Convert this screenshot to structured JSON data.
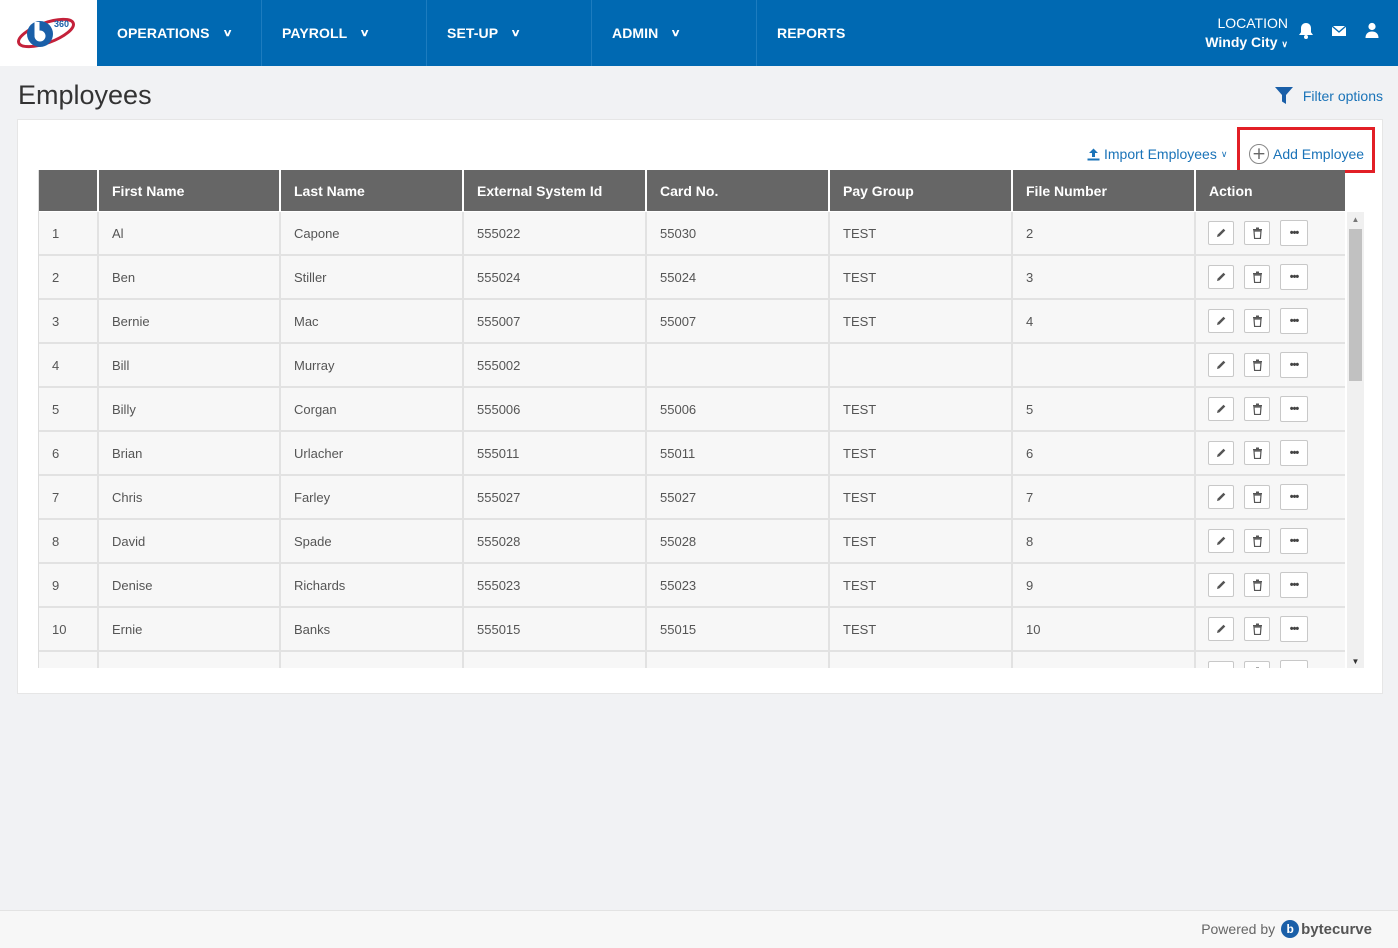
{
  "nav": {
    "logo_text": "360",
    "items": [
      {
        "label": "OPERATIONS",
        "has_menu": true
      },
      {
        "label": "PAYROLL",
        "has_menu": true
      },
      {
        "label": "SET-UP",
        "has_menu": true
      },
      {
        "label": "ADMIN",
        "has_menu": true
      },
      {
        "label": "REPORTS",
        "has_menu": false
      }
    ],
    "location_label": "LOCATION",
    "location_value": "Windy City",
    "icons": [
      "bell-icon",
      "envelope-icon",
      "user-icon"
    ]
  },
  "page": {
    "title": "Employees",
    "filter_label": "Filter options"
  },
  "toolbar": {
    "import_label": "Import Employees",
    "add_label": "Add Employee"
  },
  "table": {
    "columns": [
      "",
      "First Name",
      "Last Name",
      "External System Id",
      "Card No.",
      "Pay Group",
      "File Number",
      "Action"
    ],
    "rows": [
      {
        "num": "1",
        "first": "Al",
        "last": "Capone",
        "ext_id": "555022",
        "card": "55030",
        "pay_group": "TEST",
        "file_no": "2"
      },
      {
        "num": "2",
        "first": "Ben",
        "last": "Stiller",
        "ext_id": "555024",
        "card": "55024",
        "pay_group": "TEST",
        "file_no": "3"
      },
      {
        "num": "3",
        "first": "Bernie",
        "last": "Mac",
        "ext_id": "555007",
        "card": "55007",
        "pay_group": "TEST",
        "file_no": "4"
      },
      {
        "num": "4",
        "first": "Bill",
        "last": "Murray",
        "ext_id": "555002",
        "card": "",
        "pay_group": "",
        "file_no": ""
      },
      {
        "num": "5",
        "first": "Billy",
        "last": "Corgan",
        "ext_id": "555006",
        "card": "55006",
        "pay_group": "TEST",
        "file_no": "5"
      },
      {
        "num": "6",
        "first": "Brian",
        "last": "Urlacher",
        "ext_id": "555011",
        "card": "55011",
        "pay_group": "TEST",
        "file_no": "6"
      },
      {
        "num": "7",
        "first": "Chris",
        "last": "Farley",
        "ext_id": "555027",
        "card": "55027",
        "pay_group": "TEST",
        "file_no": "7"
      },
      {
        "num": "8",
        "first": "David",
        "last": "Spade",
        "ext_id": "555028",
        "card": "55028",
        "pay_group": "TEST",
        "file_no": "8"
      },
      {
        "num": "9",
        "first": "Denise",
        "last": "Richards",
        "ext_id": "555023",
        "card": "55023",
        "pay_group": "TEST",
        "file_no": "9"
      },
      {
        "num": "10",
        "first": "Ernie",
        "last": "Banks",
        "ext_id": "555015",
        "card": "55015",
        "pay_group": "TEST",
        "file_no": "10"
      },
      {
        "num": "",
        "first": "",
        "last": "",
        "ext_id": "",
        "card": "",
        "pay_group": "",
        "file_no": ""
      }
    ],
    "row_actions": [
      "edit-icon",
      "trash-icon",
      "more-icon"
    ],
    "more_glyph": "•••"
  },
  "footer": {
    "powered_label": "Powered by",
    "brand_name": "bytecurve"
  },
  "colors": {
    "nav_bg": "#0069b2",
    "header_bg": "#666666",
    "link": "#1a73b8",
    "highlight_border": "#e21f26"
  }
}
